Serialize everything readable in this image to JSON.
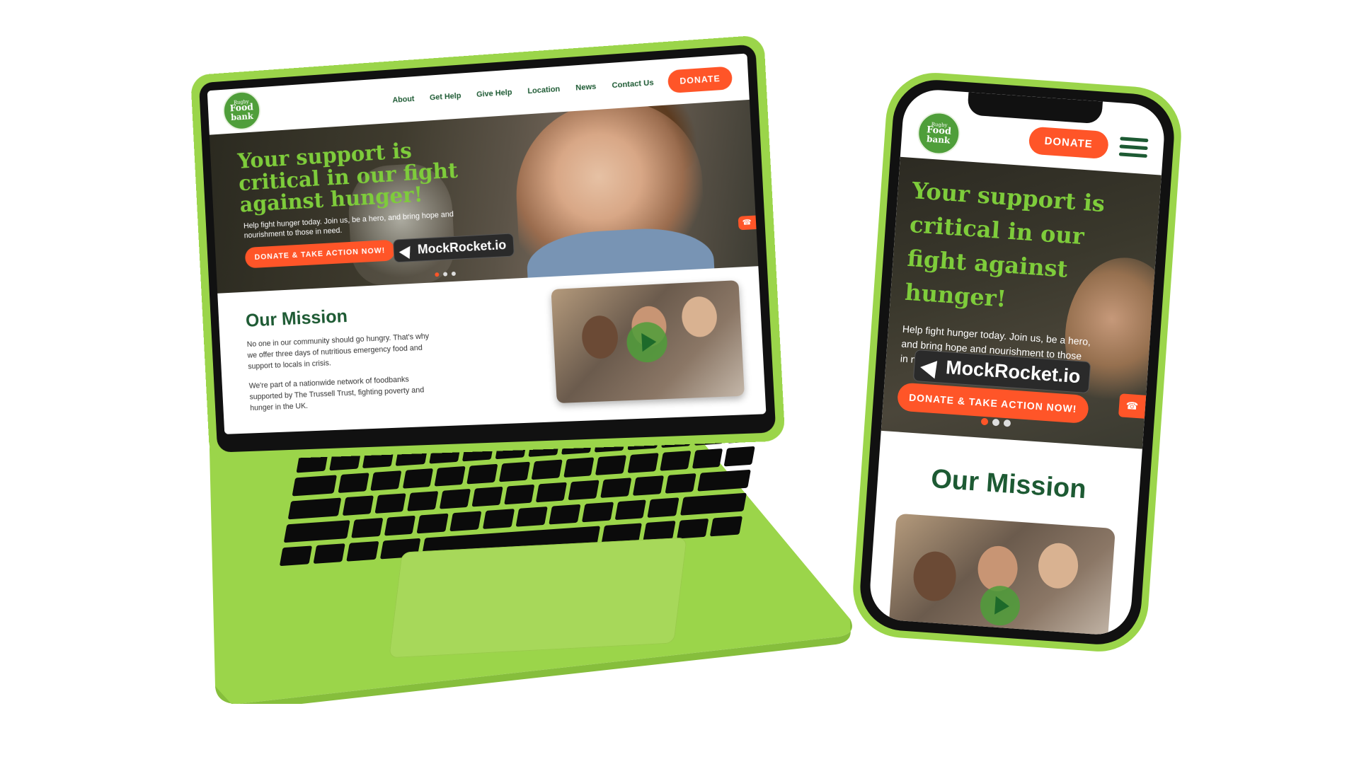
{
  "site": {
    "logo": {
      "line1": "Rugby",
      "line2": "Food",
      "line3": "bank"
    },
    "nav": [
      "About",
      "Get Help",
      "Give Help",
      "Location",
      "News",
      "Contact Us"
    ],
    "donate_label": "DONATE"
  },
  "hero": {
    "title": "Your support is critical in our fight against hunger!",
    "subtitle": "Help fight hunger today. Join us, be a hero, and bring hope and nourishment to those in need.",
    "cta": "DONATE & TAKE ACTION NOW!",
    "slides": 3,
    "active_slide": 1
  },
  "watermark": "MockRocket.io",
  "mission": {
    "heading": "Our Mission",
    "para1": "No one in our community should go hungry. That's why we offer three days of nutritious emergency food and support to locals in crisis.",
    "para2": "We're part of a nationwide network of foodbanks supported by The Trussell Trust, fighting poverty and hunger in the UK."
  },
  "colors": {
    "brand_green": "#1d5a33",
    "accent_lime": "#7ecc3b",
    "device_green": "#9bd54a",
    "donate_orange": "#ff5528"
  },
  "icons": {
    "chat": "chat-icon",
    "play": "play-icon",
    "menu": "hamburger-menu-icon",
    "watermark": "mockrocket-logo-icon"
  }
}
